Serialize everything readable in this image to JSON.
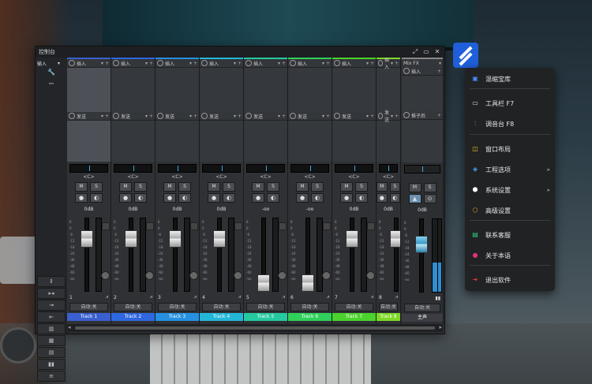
{
  "window": {
    "title": "控制台",
    "controls": [
      "⤢",
      "▭",
      "✕"
    ]
  },
  "left_panel": {
    "top_label": "输入",
    "top_arrow": "▾"
  },
  "strip_common": {
    "insert_label": "插入",
    "send_label": "发送",
    "pan_label": "<C>",
    "mute": "M",
    "solo": "S",
    "auto_label": "自动:关"
  },
  "strips": [
    {
      "num": "1",
      "name": "Track 1",
      "volume": "0dB",
      "fader_level": 0.78,
      "color": "#3a5fd0"
    },
    {
      "num": "2",
      "name": "Track 2",
      "volume": "0dB",
      "fader_level": 0.78,
      "color": "#2f67e0"
    },
    {
      "num": "3",
      "name": "Track 3",
      "volume": "0dB",
      "fader_level": 0.78,
      "color": "#2590e0"
    },
    {
      "num": "4",
      "name": "Track 4",
      "volume": "0dB",
      "fader_level": 0.78,
      "color": "#22b7d8"
    },
    {
      "num": "5",
      "name": "Track 5",
      "volume": "-oo",
      "fader_level": 0.0,
      "color": "#25c9a0"
    },
    {
      "num": "6",
      "name": "Track 6",
      "volume": "-oo",
      "fader_level": 0.0,
      "color": "#2fd15a"
    },
    {
      "num": "7",
      "name": "Track 7",
      "volume": "0dB",
      "fader_level": 0.78,
      "color": "#4bd22c"
    },
    {
      "num": "8",
      "name": "Track 8",
      "volume": "0dB",
      "fader_level": 0.78,
      "color": "#7dd826"
    }
  ],
  "master": {
    "fx_label": "Mix FX",
    "insert_label": "插入",
    "post_label": "推子后",
    "volume": "0dB",
    "name": "主声",
    "auto_label": "自动:关"
  },
  "menu": {
    "items": [
      {
        "label": "混缩宝库",
        "icon": "library-icon",
        "color": "#4a8cff"
      },
      {
        "label": "工具栏 F7",
        "icon": "toolbar-icon",
        "color": "#dddddd"
      },
      {
        "label": "调音台 F8",
        "icon": "mixer-icon",
        "color": "#dddddd"
      },
      {
        "label": "窗口布局",
        "icon": "window-layout-icon",
        "color": "#e6c228"
      },
      {
        "label": "工程选项",
        "icon": "layers-icon",
        "color": "#4aa3ff",
        "has_sub": true
      },
      {
        "label": "系统设置",
        "icon": "cube-icon",
        "color": "#ffffff",
        "has_sub": true
      },
      {
        "label": "高级设置",
        "icon": "hexagon-icon",
        "color": "#f0a030"
      },
      {
        "label": "联系客服",
        "icon": "chat-icon",
        "color": "#2fd07a"
      },
      {
        "label": "关于本语",
        "icon": "person-icon",
        "color": "#e0307a"
      },
      {
        "label": "退出软件",
        "icon": "exit-icon",
        "color": "#e0402a"
      }
    ]
  }
}
